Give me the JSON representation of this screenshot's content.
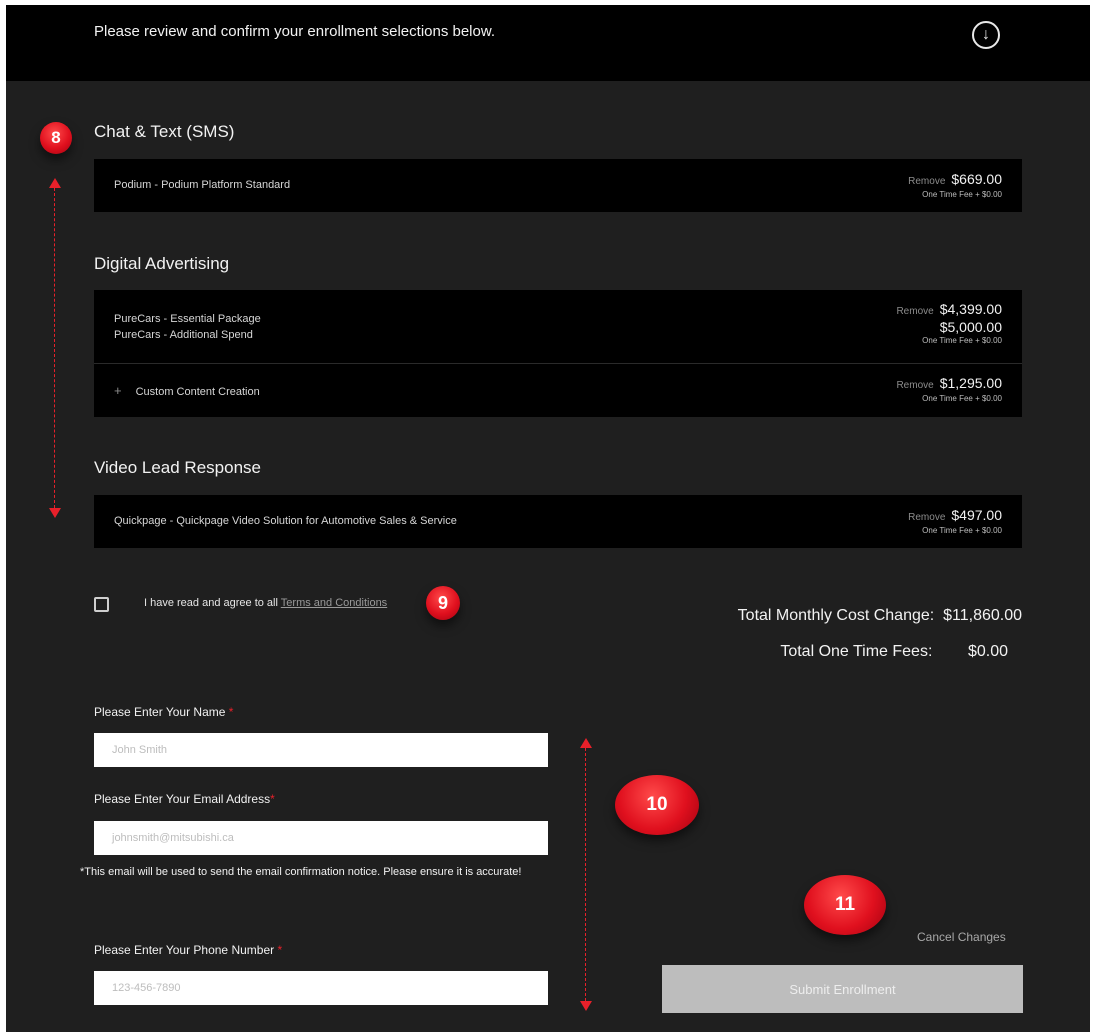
{
  "header": {
    "message": "Please review and confirm your enrollment selections below."
  },
  "sections": [
    {
      "title": "Chat & Text (SMS)",
      "items": [
        {
          "name": "Podium - Podium Platform Standard",
          "remove": "Remove",
          "price": "$669.00",
          "fee": "One Time Fee + $0.00"
        }
      ]
    },
    {
      "title": "Digital Advertising",
      "items": [
        {
          "names": [
            "PureCars - Essential Package",
            "PureCars - Additional Spend"
          ],
          "remove": "Remove",
          "prices": [
            "$4,399.00",
            "$5,000.00"
          ],
          "fee": "One Time Fee + $0.00"
        },
        {
          "plus": "+",
          "name": "Custom Content Creation",
          "remove": "Remove",
          "price": "$1,295.00",
          "fee": "One Time Fee + $0.00"
        }
      ]
    },
    {
      "title": "Video Lead Response",
      "items": [
        {
          "name": "Quickpage - Quickpage Video Solution for Automotive Sales & Service",
          "remove": "Remove",
          "price": "$497.00",
          "fee": "One Time Fee + $0.00"
        }
      ]
    }
  ],
  "agreement": {
    "text": "I have read and agree to all ",
    "link": "Terms and Conditions"
  },
  "totals": {
    "monthly_label": "Total Monthly Cost Change:",
    "monthly_value": "$11,860.00",
    "onetime_label": "Total One Time Fees:",
    "onetime_value": "$0.00"
  },
  "form": {
    "name_label": "Please Enter Your Name ",
    "name_placeholder": "John Smith",
    "email_label": "Please Enter Your Email Address",
    "email_placeholder": "johnsmith@mitsubishi.ca",
    "email_note": "*This email will be used to send the email confirmation notice. Please ensure it is accurate!",
    "phone_label": "Please Enter Your Phone Number ",
    "phone_placeholder": "123-456-7890",
    "required_mark": "*"
  },
  "actions": {
    "cancel": "Cancel Changes",
    "submit": "Submit Enrollment"
  },
  "annotations": {
    "b8": "8",
    "b9": "9",
    "b10": "10",
    "b11": "11"
  },
  "colors": {
    "accent": "#e8202a",
    "background": "#1f1f1f",
    "row": "#000000",
    "submit_bg": "#bdbdbd"
  },
  "icons": {
    "download": "arrow-down-circle-icon"
  }
}
